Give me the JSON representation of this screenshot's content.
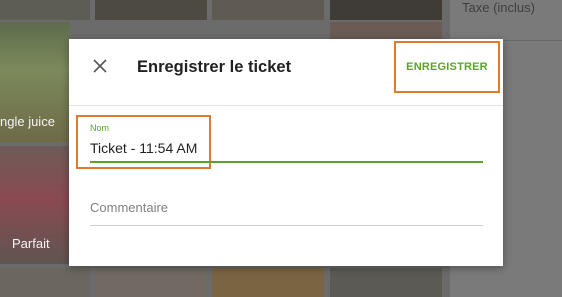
{
  "background": {
    "tiles": [
      {
        "label": "ngle juice"
      },
      {
        "label": "Parfait"
      }
    ],
    "right_panel_title": "Taxe (inclus)"
  },
  "dialog": {
    "close_icon": "close-icon",
    "title": "Enregistrer le ticket",
    "save_label": "ENREGISTRER",
    "name_field": {
      "label": "Nom",
      "value": "Ticket - 11:54 AM"
    },
    "comment_field": {
      "placeholder": "Commentaire",
      "value": ""
    }
  },
  "colors": {
    "accent_green": "#5aa42b",
    "highlight_orange": "#e07b2e"
  }
}
